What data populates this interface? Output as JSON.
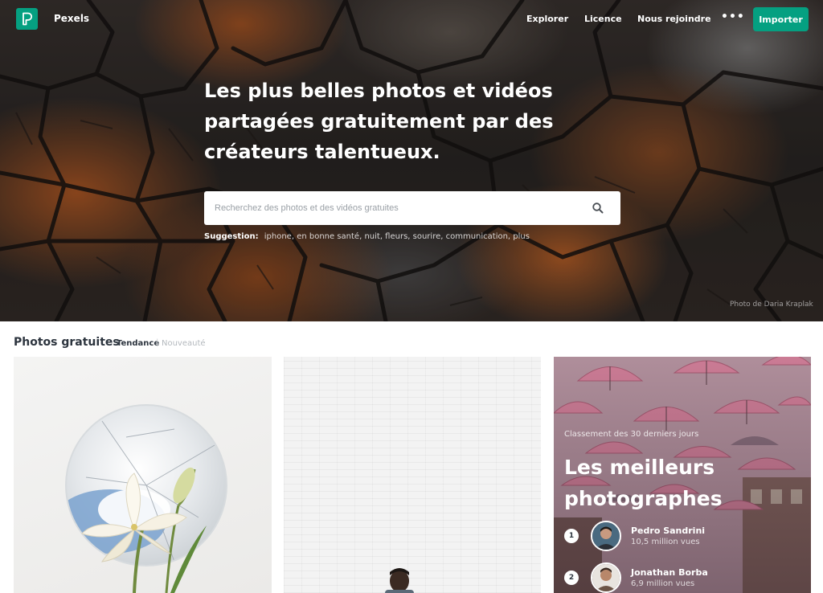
{
  "nav": {
    "brand": "Pexels",
    "links": [
      "Explorer",
      "Licence",
      "Nous rejoindre"
    ],
    "more": "•••",
    "upload_label": "Importer"
  },
  "hero": {
    "title": "Les plus belles photos et vidéos partagées gratuitement par des créateurs talentueux.",
    "search_placeholder": "Recherchez des photos et des vidéos gratuites",
    "suggestion_label": "Suggestion:",
    "suggestions": "iphone, en bonne santé, nuit, fleurs, sourire, communication, plus",
    "credit": "Photo de Daria Kraplak"
  },
  "section": {
    "title": "Photos gratuites",
    "tab_active": "Tendance",
    "separator": "|",
    "tab_inactive": "Nouveauté"
  },
  "ranking": {
    "subtitle": "Classement des 30 derniers jours",
    "title": "Les meilleurs photographes",
    "photographers": [
      {
        "rank": "1",
        "name": "Pedro Sandrini",
        "views": "10,5 million vues"
      },
      {
        "rank": "2",
        "name": "Jonathan Borba",
        "views": "6,9 million vues"
      }
    ]
  },
  "colors": {
    "accent": "#05a081",
    "text": "#2c343e"
  },
  "icons": [
    "pexels-logo-icon",
    "search-icon"
  ]
}
